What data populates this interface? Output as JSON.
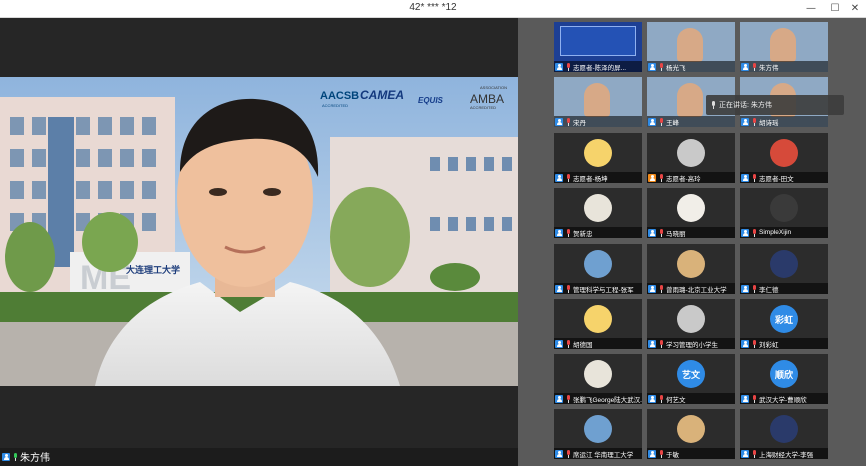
{
  "window": {
    "title": "42* *** *12",
    "minimize": "—",
    "maximize": "☐",
    "close": "✕"
  },
  "speaker": {
    "name": "朱方伟",
    "badges": [
      "AACSB",
      "ACCREDITED",
      "CAMEA",
      "EQUIS",
      "AMBA",
      "ASSOCIATION",
      "ACCREDITED"
    ],
    "building_sign": "大连理工大学"
  },
  "speaking_indicator": {
    "label": "正在讲话: 朱方伟"
  },
  "participants": [
    {
      "name": "志愿者-陈泽的屏...",
      "avatar_type": "screen"
    },
    {
      "name": "杨光飞",
      "avatar_type": "video"
    },
    {
      "name": "朱方伟",
      "avatar_type": "video"
    },
    {
      "name": "宋丹",
      "avatar_type": "video"
    },
    {
      "name": "王峰",
      "avatar_type": "video"
    },
    {
      "name": "胡诗瑶",
      "avatar_type": "video"
    },
    {
      "name": "志愿者-杨坤",
      "avatar_type": "photo"
    },
    {
      "name": "志愿者-高玲",
      "avatar_type": "photo"
    },
    {
      "name": "志愿者-田文",
      "avatar_type": "photo"
    },
    {
      "name": "贺新忠",
      "avatar_type": "photo"
    },
    {
      "name": "马晓丽",
      "avatar_type": "photo"
    },
    {
      "name": "SimpleXijin",
      "avatar_type": "photo"
    },
    {
      "name": "管理科学与工程-张军",
      "avatar_type": "photo"
    },
    {
      "name": "曾雨璐-北京工业大学",
      "avatar_type": "photo"
    },
    {
      "name": "李仁德",
      "avatar_type": "photo"
    },
    {
      "name": "胡德国",
      "avatar_type": "photo"
    },
    {
      "name": "学习管理的小学生",
      "avatar_type": "photo"
    },
    {
      "name": "刘彩虹",
      "avatar_type": "text",
      "avatar_text": "彩虹"
    },
    {
      "name": "张鹏飞George陆大武汉...",
      "avatar_type": "photo"
    },
    {
      "name": "何艺文",
      "avatar_type": "text",
      "avatar_text": "艺文"
    },
    {
      "name": "武汉大学-曹顺欣",
      "avatar_type": "text",
      "avatar_text": "顺欣"
    },
    {
      "name": "席运江 华南理工大学",
      "avatar_type": "photo"
    },
    {
      "name": "于敏",
      "avatar_type": "photo"
    },
    {
      "name": "上海财经大学-李强",
      "avatar_type": "photo"
    }
  ],
  "colors": {
    "accent_blue": "#2f8be6",
    "panel_bg": "#5a5a5a",
    "tile_bg": "#2c2c2c",
    "mic_muted": "#e84545",
    "mic_active": "#34c759"
  }
}
